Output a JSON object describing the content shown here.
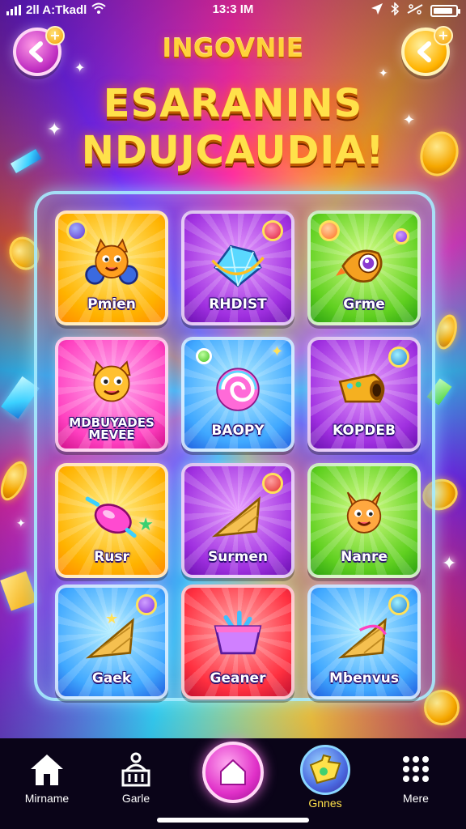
{
  "status_bar": {
    "carrier": "2ll A:Tkadl",
    "time": "13:3 IM",
    "battery_level_percent": 90
  },
  "header": {
    "back_icon": "chevron-left-icon",
    "gold_button_icon": "chevron-left-icon",
    "title_small": "INGOVNIE",
    "title_line1": "ESARANINS",
    "title_line2": "NDUJCAUDIA!"
  },
  "grid": {
    "tiles": [
      {
        "label": "Pmien",
        "label2": "",
        "color": "yellow",
        "icon": "cat-character-icon"
      },
      {
        "label": "RHDIST",
        "label2": "",
        "color": "purple",
        "icon": "diamond-gem-icon"
      },
      {
        "label": "Grme",
        "label2": "",
        "color": "green",
        "icon": "eye-rocket-icon"
      },
      {
        "label": "MDBUYADES",
        "label2": "MEVEE",
        "color": "pink",
        "icon": "cat-character-icon"
      },
      {
        "label": "BAOPY",
        "label2": "",
        "color": "blue",
        "icon": "lollipop-candy-icon"
      },
      {
        "label": "KOPDEB",
        "label2": "",
        "color": "purple",
        "icon": "golden-cannon-icon"
      },
      {
        "label": "Rusr",
        "label2": "",
        "color": "yellow",
        "icon": "pink-gem-wand-icon"
      },
      {
        "label": "Surmen",
        "label2": "",
        "color": "purple",
        "icon": "golden-cone-icon"
      },
      {
        "label": "Nanre",
        "label2": "",
        "color": "green",
        "icon": "fox-character-icon"
      },
      {
        "label": "Gaek",
        "label2": "",
        "color": "blue",
        "icon": "golden-cone-icon"
      },
      {
        "label": "Geaner",
        "label2": "",
        "color": "red",
        "icon": "treasure-basket-icon"
      },
      {
        "label": "Mbenvus",
        "label2": "",
        "color": "blue",
        "icon": "golden-cone-icon"
      }
    ]
  },
  "bottom_nav": {
    "items": [
      {
        "label": "Mirname",
        "icon": "home-icon"
      },
      {
        "label": "Garle",
        "icon": "building-icon"
      },
      {
        "label": "",
        "icon": "center-home-icon"
      },
      {
        "label": "Gnnes",
        "icon": "puzzle-games-icon"
      },
      {
        "label": "Mere",
        "icon": "more-dots-icon"
      }
    ]
  },
  "colors": {
    "title_gold": "#ffd23a",
    "panel_border": "#aaf0ff",
    "nav_bg": "#0a0418"
  }
}
